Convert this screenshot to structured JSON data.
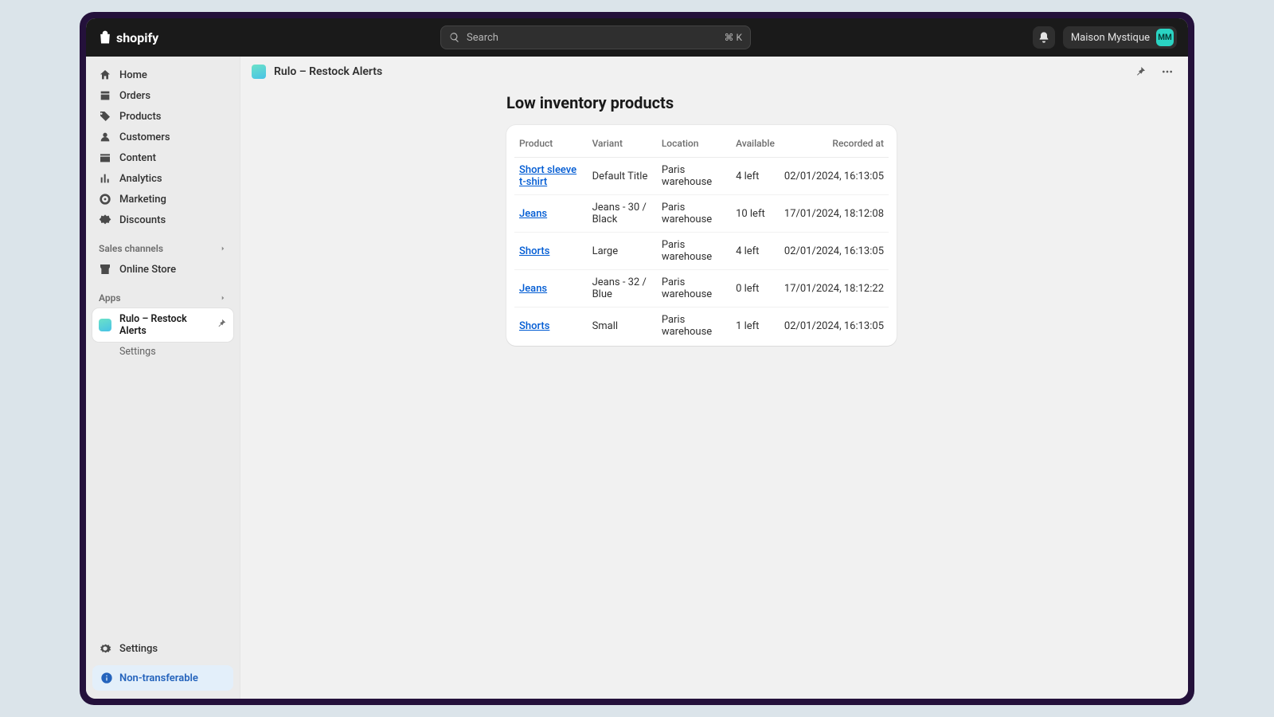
{
  "brand": "shopify",
  "search": {
    "placeholder": "Search",
    "shortcut": "⌘ K"
  },
  "store": {
    "name": "Maison Mystique",
    "initials": "MM"
  },
  "sidebar": {
    "nav": [
      {
        "label": "Home"
      },
      {
        "label": "Orders"
      },
      {
        "label": "Products"
      },
      {
        "label": "Customers"
      },
      {
        "label": "Content"
      },
      {
        "label": "Analytics"
      },
      {
        "label": "Marketing"
      },
      {
        "label": "Discounts"
      }
    ],
    "sales_channels_label": "Sales channels",
    "online_store_label": "Online Store",
    "apps_label": "Apps",
    "app_item_label": "Rulo – Restock Alerts",
    "app_sub_label": "Settings",
    "settings_label": "Settings",
    "non_transferable_label": "Non-transferable"
  },
  "page": {
    "breadcrumb": "Rulo – Restock Alerts",
    "title": "Low inventory products"
  },
  "table": {
    "headers": {
      "product": "Product",
      "variant": "Variant",
      "location": "Location",
      "available": "Available",
      "recorded": "Recorded at"
    },
    "rows": [
      {
        "product": "Short sleeve t-shirt",
        "variant": "Default Title",
        "location": "Paris warehouse",
        "available": "4 left",
        "recorded": "02/01/2024, 16:13:05"
      },
      {
        "product": "Jeans",
        "variant": "Jeans - 30 / Black",
        "location": "Paris warehouse",
        "available": "10 left",
        "recorded": "17/01/2024, 18:12:08"
      },
      {
        "product": "Shorts",
        "variant": "Large",
        "location": "Paris warehouse",
        "available": "4 left",
        "recorded": "02/01/2024, 16:13:05"
      },
      {
        "product": "Jeans",
        "variant": "Jeans - 32 / Blue",
        "location": "Paris warehouse",
        "available": "0 left",
        "recorded": "17/01/2024, 18:12:22"
      },
      {
        "product": "Shorts",
        "variant": "Small",
        "location": "Paris warehouse",
        "available": "1 left",
        "recorded": "02/01/2024, 16:13:05"
      }
    ]
  }
}
